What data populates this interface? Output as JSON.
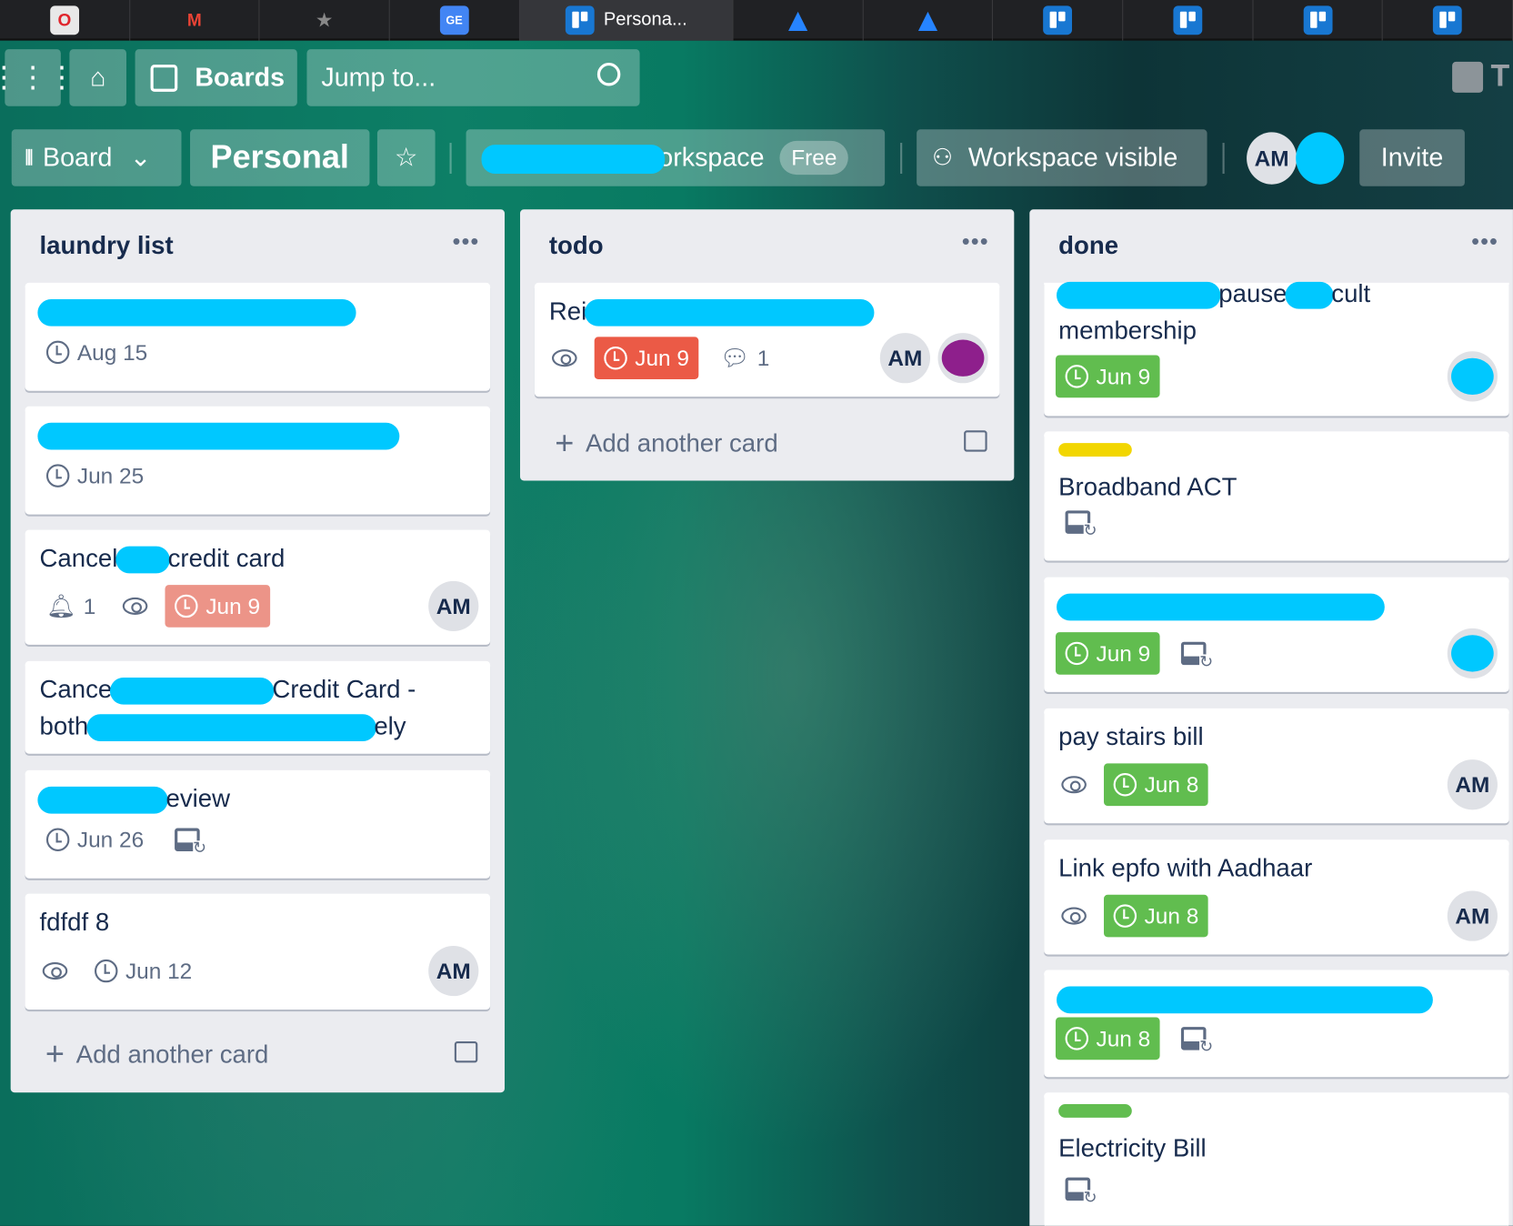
{
  "browser_tabs": [
    {
      "icon": "opera-icon"
    },
    {
      "icon": "gmail-icon"
    },
    {
      "icon": "star-bookmark-icon"
    },
    {
      "icon": "google-sheets-icon"
    },
    {
      "icon": "trello-icon",
      "label": "Persona...",
      "active": true
    },
    {
      "icon": "atlassian-icon"
    },
    {
      "icon": "atlassian-icon"
    },
    {
      "icon": "trello-icon"
    },
    {
      "icon": "trello-icon"
    },
    {
      "icon": "trello-icon"
    },
    {
      "icon": "trello-icon"
    }
  ],
  "topnav": {
    "boards": "Boards",
    "search_placeholder": "Jump to...",
    "right_letter": "T"
  },
  "board_header": {
    "view": "Board",
    "title": "Personal",
    "workspace_suffix": "workspace",
    "workspace_plan": "Free",
    "visibility": "Workspace visible",
    "member": "AM",
    "invite": "Invite"
  },
  "colors": {
    "accent_red": "#eb5a46",
    "due_green": "#61bd4f",
    "due_soon_red": "#ec9488",
    "label_yellow": "#f2d600",
    "label_green": "#61bd4f",
    "redaction": "#00c8ff"
  },
  "lists": [
    {
      "title": "laundry list",
      "add_label": "Add another card",
      "cards": [
        {
          "title": [
            {
              "r": 330
            }
          ],
          "badges": [
            {
              "type": "due",
              "text": "Aug 15",
              "style": "plain"
            }
          ]
        },
        {
          "title": [
            {
              "r": 375
            }
          ],
          "badges": [
            {
              "type": "due",
              "text": "Jun 25",
              "style": "plain"
            }
          ]
        },
        {
          "title": [
            {
              "t": "Cancel"
            },
            {
              "r": 56
            },
            {
              "t": "credit card"
            }
          ],
          "badges": [
            {
              "type": "notification",
              "text": "1"
            },
            {
              "type": "watch"
            },
            {
              "type": "due",
              "text": "Jun 9",
              "style": "lightred"
            }
          ],
          "member": "AM"
        },
        {
          "title": [
            {
              "t": "Cance"
            },
            {
              "r": 170
            },
            {
              "t": "Credit Card -"
            },
            {
              "br": 1
            },
            {
              "t": "both"
            },
            {
              "r": 300
            },
            {
              "t": "ely"
            }
          ],
          "badges": []
        },
        {
          "title": [
            {
              "r": 135
            },
            {
              "t": "eview"
            }
          ],
          "badges": [
            {
              "type": "due",
              "text": "Jun 26",
              "style": "plain"
            },
            {
              "type": "template"
            }
          ]
        },
        {
          "title": [
            {
              "t": "fdfdf 8"
            }
          ],
          "badges": [
            {
              "type": "watch"
            },
            {
              "type": "due",
              "text": "Jun 12",
              "style": "plain"
            }
          ],
          "member": "AM"
        }
      ]
    },
    {
      "title": "todo",
      "add_label": "Add another card",
      "cards": [
        {
          "title": [
            {
              "t": "Rei"
            },
            {
              "r": 300
            }
          ],
          "badges": [
            {
              "type": "watch"
            },
            {
              "type": "due",
              "text": "Jun 9",
              "style": "red"
            },
            {
              "type": "comments",
              "text": "1"
            }
          ],
          "member": "AM",
          "member2": "purple"
        }
      ]
    },
    {
      "title": "done",
      "cards": [
        {
          "title": [
            {
              "r": 170
            },
            {
              "t": "pause"
            },
            {
              "r": 50
            },
            {
              "t": "cult"
            },
            {
              "br": 1
            },
            {
              "t": "membership"
            }
          ],
          "badges": [
            {
              "type": "due",
              "text": "Jun 9",
              "style": "green"
            }
          ],
          "member2": "redacted"
        },
        {
          "label": "#f2d600",
          "title": [
            {
              "t": "Broadband ACT"
            }
          ],
          "badges": [
            {
              "type": "template"
            }
          ]
        },
        {
          "title": [
            {
              "r": 340
            }
          ],
          "badges": [
            {
              "type": "due",
              "text": "Jun 9",
              "style": "green"
            },
            {
              "type": "template"
            }
          ],
          "member2": "redacted"
        },
        {
          "title": [
            {
              "t": "pay stairs bill"
            }
          ],
          "badges": [
            {
              "type": "watch"
            },
            {
              "type": "due",
              "text": "Jun 8",
              "style": "green"
            }
          ],
          "member": "AM"
        },
        {
          "title": [
            {
              "t": "Link epfo with Aadhaar"
            }
          ],
          "badges": [
            {
              "type": "watch"
            },
            {
              "type": "due",
              "text": "Jun 8",
              "style": "green"
            }
          ],
          "member": "AM"
        },
        {
          "title": [
            {
              "r": 390
            }
          ],
          "badges": [
            {
              "type": "due",
              "text": "Jun 8",
              "style": "green"
            },
            {
              "type": "template"
            }
          ]
        },
        {
          "label": "#61bd4f",
          "title": [
            {
              "t": "Electricity Bill"
            }
          ],
          "badges": [
            {
              "type": "template"
            }
          ]
        }
      ]
    }
  ]
}
